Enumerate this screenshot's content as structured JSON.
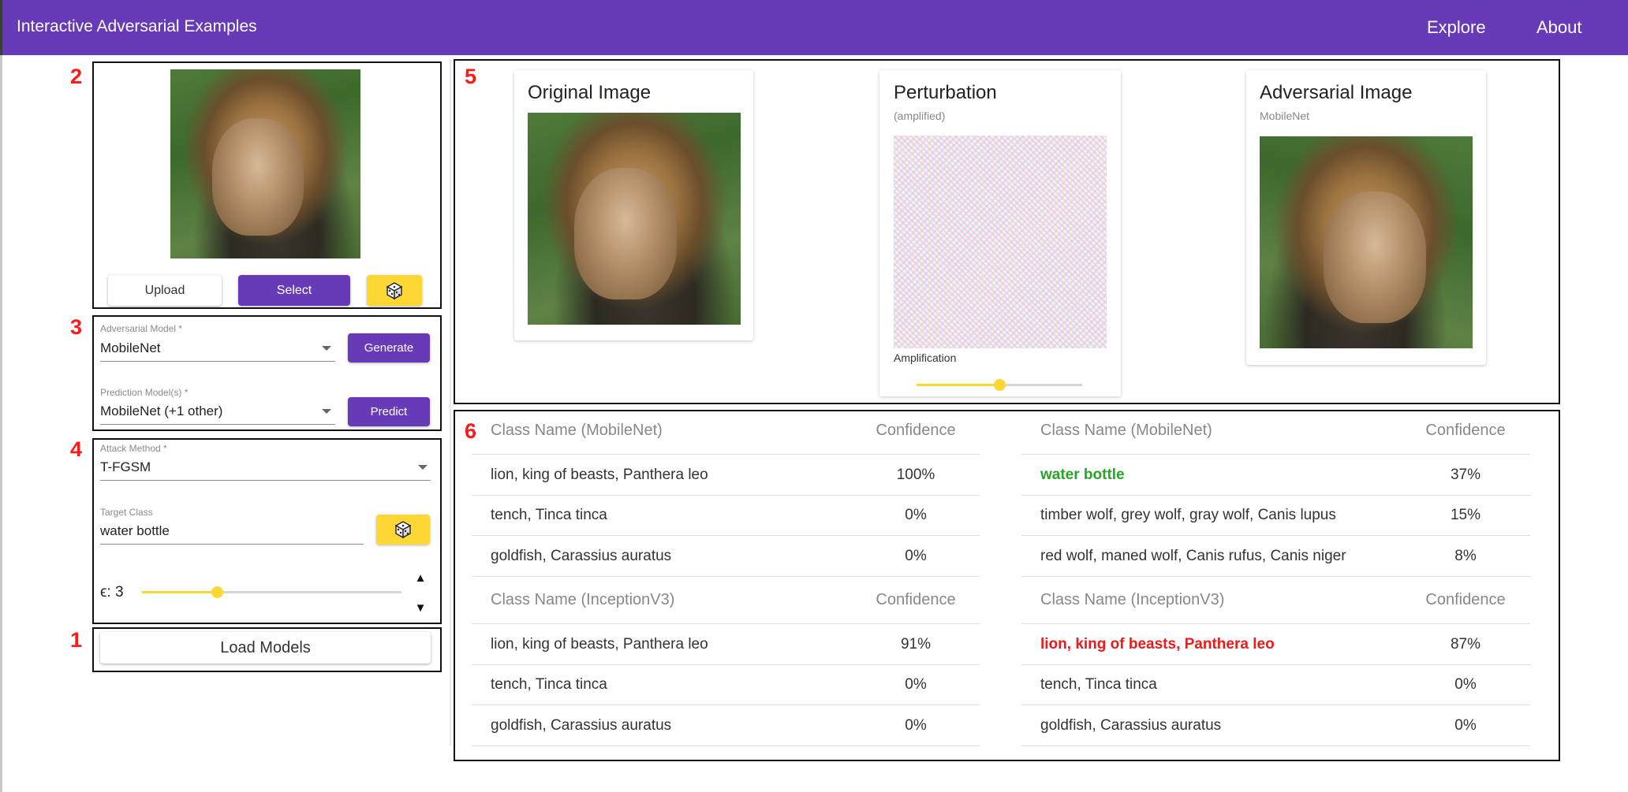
{
  "app": {
    "title": "Interactive Adversarial Examples",
    "nav": [
      "Explore",
      "About"
    ]
  },
  "annotations": [
    "2",
    "3",
    "4",
    "1",
    "5",
    "6"
  ],
  "image_panel": {
    "upload_label": "Upload",
    "select_label": "Select",
    "random_icon": "dice-icon"
  },
  "adversarial_model": {
    "label": "Adversarial Model *",
    "value": "MobileNet",
    "button": "Generate"
  },
  "prediction_models": {
    "label": "Prediction Model(s) *",
    "value": "MobileNet (+1 other)",
    "button": "Predict"
  },
  "attack": {
    "method_label": "Attack Method *",
    "method_value": "T-FGSM",
    "target_label": "Target Class",
    "target_value": "water bottle",
    "epsilon_label": "ϵ:",
    "epsilon_value": "3",
    "epsilon_fraction": 0.29,
    "step_up": "▲",
    "step_down": "▼"
  },
  "load_models": "Load Models",
  "images": {
    "original": {
      "title": "Original Image"
    },
    "perturbation": {
      "title": "Perturbation",
      "subtitle": "(amplified)",
      "slider_label": "Amplification",
      "amplification_fraction": 0.5
    },
    "adversarial": {
      "title": "Adversarial Image",
      "subtitle": "MobileNet"
    }
  },
  "colors": {
    "primary": "#673ab7",
    "accent": "#fdd835",
    "success": "#29a329",
    "error": "#f01818"
  },
  "tables": {
    "mobilenet_original": {
      "header": [
        "Class Name (MobileNet)",
        "Confidence"
      ],
      "rows": [
        [
          "lion, king of beasts, Panthera leo",
          "100%"
        ],
        [
          "tench, Tinca tinca",
          "0%"
        ],
        [
          "goldfish, Carassius auratus",
          "0%"
        ]
      ]
    },
    "mobilenet_adversarial": {
      "header": [
        "Class Name (MobileNet)",
        "Confidence"
      ],
      "rows": [
        [
          "water bottle",
          "37%"
        ],
        [
          "timber wolf, grey wolf, gray wolf, Canis lupus",
          "15%"
        ],
        [
          "red wolf, maned wolf, Canis rufus, Canis niger",
          "8%"
        ]
      ]
    },
    "inception_original": {
      "header": [
        "Class Name (InceptionV3)",
        "Confidence"
      ],
      "rows": [
        [
          "lion, king of beasts, Panthera leo",
          "91%"
        ],
        [
          "tench, Tinca tinca",
          "0%"
        ],
        [
          "goldfish, Carassius auratus",
          "0%"
        ]
      ]
    },
    "inception_adversarial": {
      "header": [
        "Class Name (InceptionV3)",
        "Confidence"
      ],
      "rows": [
        [
          "lion, king of beasts, Panthera leo",
          "87%"
        ],
        [
          "tench, Tinca tinca",
          "0%"
        ],
        [
          "goldfish, Carassius auratus",
          "0%"
        ]
      ]
    }
  }
}
